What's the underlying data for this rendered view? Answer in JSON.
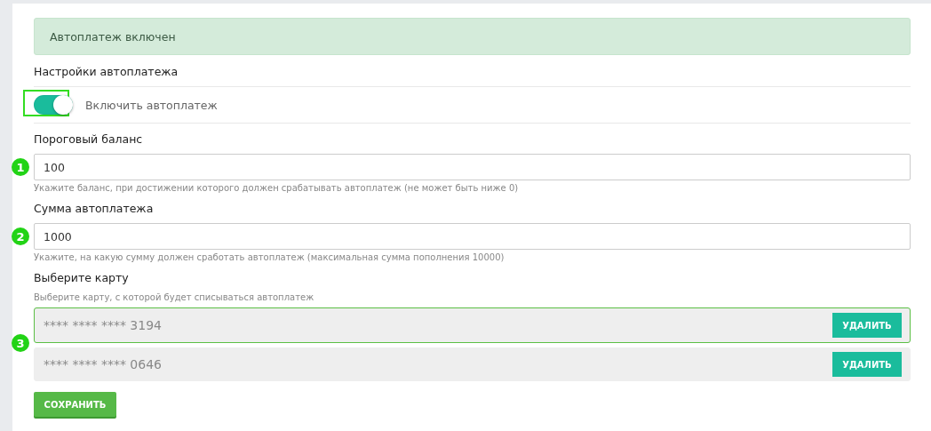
{
  "alert": {
    "text": "Автоплатеж включен"
  },
  "section_title": "Настройки автоплатежа",
  "toggle": {
    "label": "Включить автоплатеж",
    "on": true,
    "highlighted": true
  },
  "fields": [
    {
      "label": "Пороговый баланс",
      "value": "100",
      "hint": "Укажите баланс, при достижении которого должен срабатывать автоплатеж (не может быть ниже 0)",
      "marker": "1"
    },
    {
      "label": "Сумма автоплатежа",
      "value": "1000",
      "hint": "Укажите, на какую сумму должен сработать автоплатеж (максимальная сумма пополнения 10000)",
      "marker": "2"
    }
  ],
  "cards_label": "Выберите карту",
  "cards_hint": "Выберите карту, с которой будет списываться автоплатеж",
  "cards_marker": "3",
  "cards": [
    {
      "mask": "**** **** ****",
      "last4": "3194",
      "selected": true,
      "button": "УДАЛИТЬ"
    },
    {
      "mask": "**** **** ****",
      "last4": "0646",
      "selected": false,
      "button": "УДАЛИТЬ"
    }
  ],
  "save_button": "СОХРАНИТЬ"
}
